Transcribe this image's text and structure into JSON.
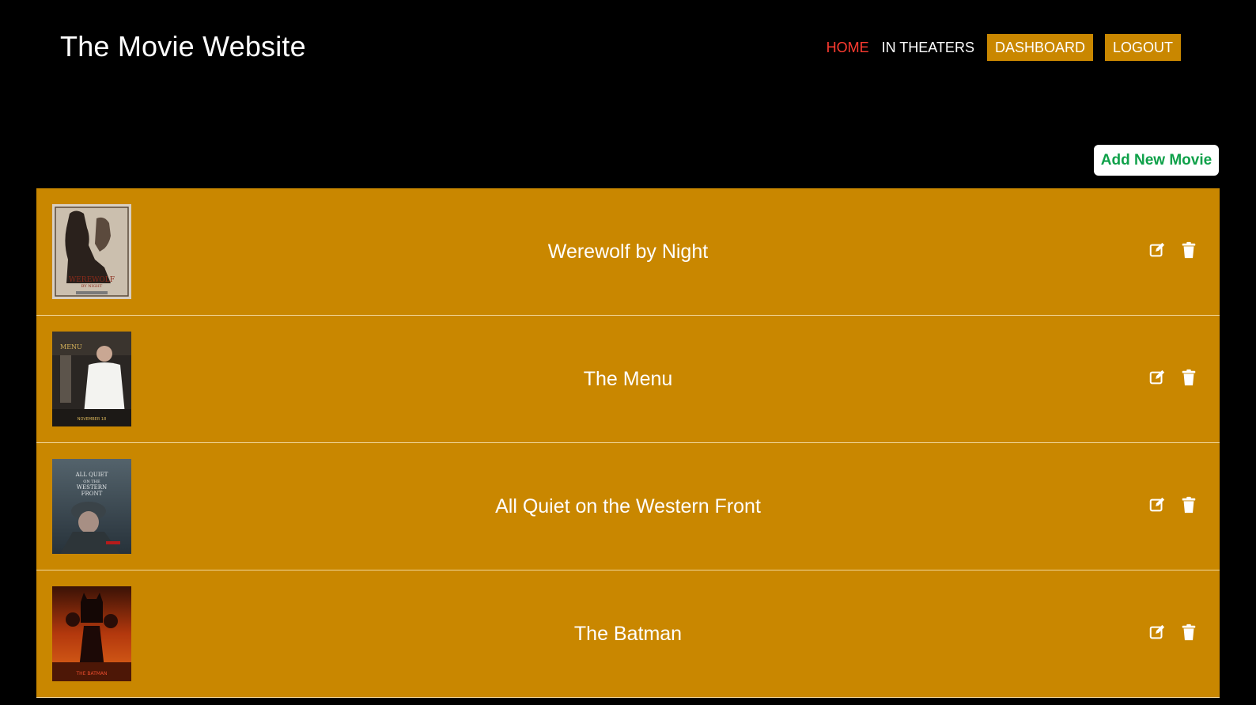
{
  "header": {
    "site_title": "The Movie Website",
    "nav": {
      "home": "HOME",
      "in_theaters": "IN THEATERS",
      "dashboard": "DASHBOARD",
      "logout": "LOGOUT"
    }
  },
  "actions": {
    "add_movie_label": "Add New Movie"
  },
  "movies": [
    {
      "title": "Werewolf by Night",
      "poster_icon": "werewolf-by-night-poster"
    },
    {
      "title": "The Menu",
      "poster_icon": "the-menu-poster"
    },
    {
      "title": "All Quiet on the Western Front",
      "poster_icon": "all-quiet-poster"
    },
    {
      "title": "The Batman",
      "poster_icon": "the-batman-poster"
    }
  ],
  "colors": {
    "background": "#000000",
    "accent": "#c98700",
    "nav_active": "#ff3b30",
    "add_button_text": "#0fa14a"
  }
}
